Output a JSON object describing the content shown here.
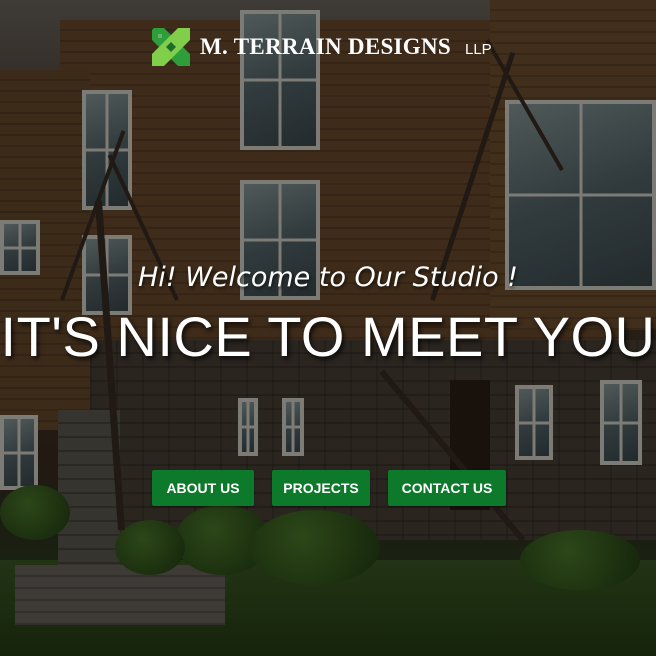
{
  "brand": {
    "name": "M. TERRAIN DESIGNS",
    "suffix": "LLP",
    "logo_icon": "crossed-x-logo-icon",
    "logo_colors": [
      "#2e9e3a",
      "#7fcf4a",
      "#1f6b2a"
    ]
  },
  "hero": {
    "welcome": "Hi! Welcome to Our Studio !",
    "headline": "IT'S NICE TO MEET YOU",
    "background": "building-photo"
  },
  "buttons": [
    {
      "label": "ABOUT US"
    },
    {
      "label": "PROJECTS"
    },
    {
      "label": "CONTACT US"
    }
  ],
  "colors": {
    "button_bg": "#0d7a2b",
    "text": "#ffffff"
  }
}
